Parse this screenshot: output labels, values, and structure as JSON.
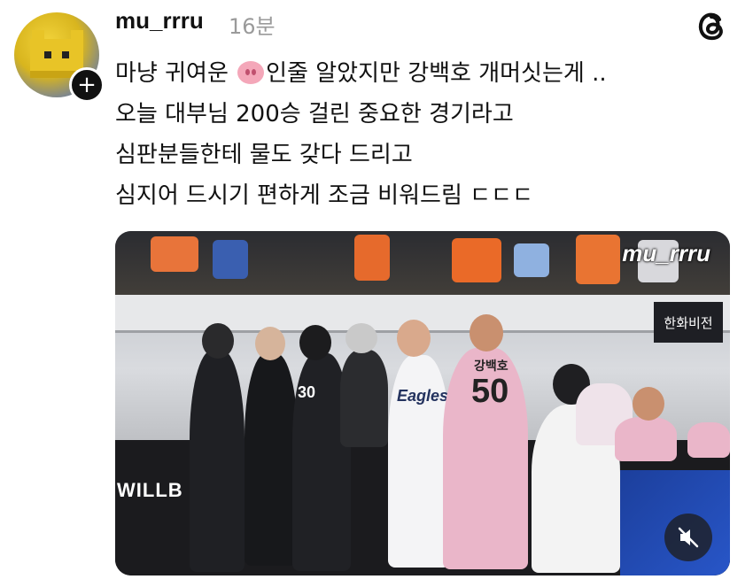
{
  "post": {
    "username": "mu_rrru",
    "time": "16분",
    "lines": [
      {
        "before_emoji": "마냥 귀여운",
        "emoji": "pig-face",
        "after_emoji": "인줄 알았지만 강백호 개머싯는게 .."
      },
      {
        "text": "오늘 대부님 200승 걸린 중요한 경기라고"
      },
      {
        "text": "심판분들한테 물도 갖다 드리고"
      },
      {
        "text": "심지어 드시기 편하게 조금 비워드림 ㄷㄷㄷ"
      }
    ]
  },
  "video": {
    "watermark": "mu_rrru",
    "sign_text": "한화비전",
    "wordmark": "WILLB",
    "jersey_number_left": "30",
    "jersey_number_center": "50",
    "jersey_name_center": "강백호",
    "uniform_script": "Eagles"
  },
  "icons": {
    "app_logo": "threads-logo-icon",
    "follow": "plus-icon",
    "mute": "speaker-muted-icon"
  },
  "colors": {
    "text": "#111111",
    "muted": "#9a9a9a",
    "pink_jersey": "#eab6c9"
  }
}
